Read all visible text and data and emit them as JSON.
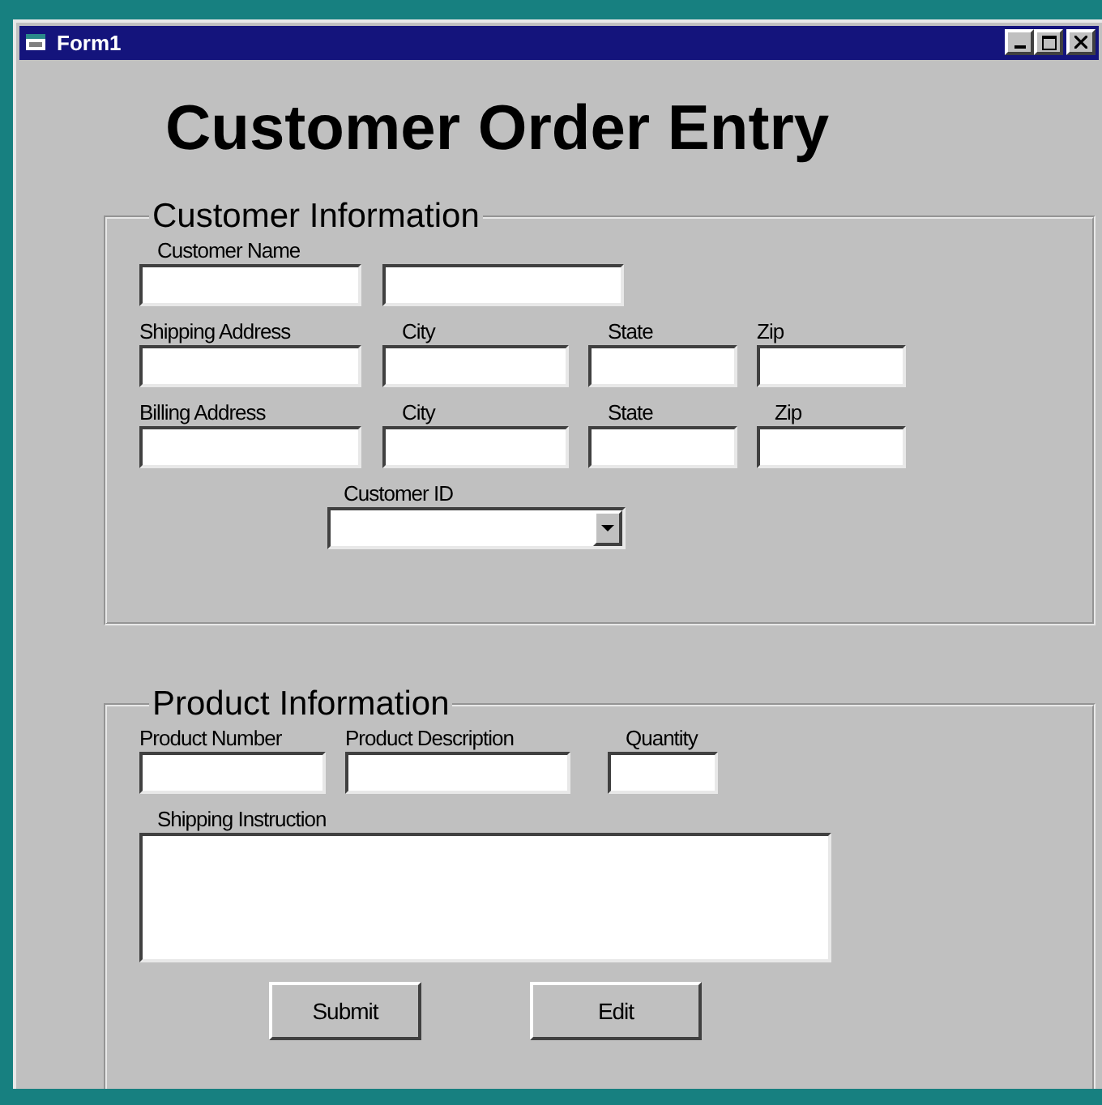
{
  "window": {
    "title": "Form1"
  },
  "heading": "Customer Order Entry",
  "customer_information": {
    "legend": "Customer Information",
    "rows": [
      {
        "labels": [
          "Customer Name"
        ],
        "fields": [
          {
            "kind": "text"
          },
          {
            "kind": "text"
          }
        ]
      },
      {
        "labels": [
          "Shipping Address",
          "City",
          "State",
          "Zip"
        ],
        "fields": [
          {
            "kind": "text"
          },
          {
            "kind": "text"
          },
          {
            "kind": "text"
          },
          {
            "kind": "text"
          }
        ]
      },
      {
        "labels": [
          "Billing Address",
          "City",
          "State",
          "Zip"
        ],
        "fields": [
          {
            "kind": "text"
          },
          {
            "kind": "text"
          },
          {
            "kind": "text"
          },
          {
            "kind": "text"
          }
        ]
      },
      {
        "labels": [
          "Customer ID"
        ],
        "fields": [
          {
            "kind": "combo"
          }
        ]
      }
    ]
  },
  "product_information": {
    "legend": "Product Information",
    "rows": [
      {
        "labels": [
          "Product Number",
          "Product Description",
          "Quantity"
        ],
        "fields": [
          {
            "kind": "text"
          },
          {
            "kind": "text"
          },
          {
            "kind": "text"
          }
        ]
      },
      {
        "labels": [
          "Shipping Instruction"
        ],
        "fields": [
          {
            "kind": "textarea"
          }
        ]
      }
    ]
  },
  "buttons": [
    "Submit",
    "Edit"
  ]
}
